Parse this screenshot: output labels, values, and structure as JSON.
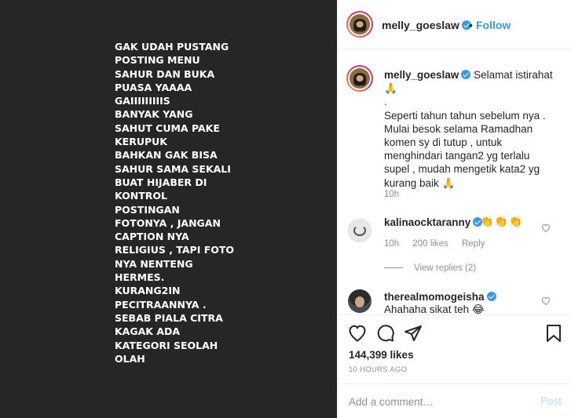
{
  "post": {
    "image_text": "GAK UDAH PUSTANG\nPOSTING MENU\nSAHUR DAN BUKA\nPUASA YAAAA\nGAIIIIIIIIIS\nBANYAK YANG\nSAHUT CUMA PAKE\nKERUPUK\nBAHKAN GAK BISA\nSAHUR SAMA SEKALI\nBUAT HIJABER DI\nKONTROL\nPOSTINGAN\nFOTONYA , JANGAN\nCAPTION NYA\nRELIGIUS , TAPI FOTO\nNYA NENTENG\nHERMES.\nKURANG2IN\nPECITRAANNYA .\nSEBAB PIALA CITRA\nKAGAK ADA\nKATEGORI SEOLAH\nOLAH"
  },
  "header": {
    "username": "melly_goeslaw",
    "separator": "•",
    "follow_label": "Follow"
  },
  "caption": {
    "username": "melly_goeslaw",
    "text": "Selamat istirahat 🙏\n.\nSeperti tahun tahun sebelum nya .\nMulai besok selama Ramadhan\nkomen sy di tutup , untuk\nmenghindari tangan2 yg terlalu\nsupel , mudah mengetik kata2 yg\nkurang baik 🙏",
    "time": "10h"
  },
  "comments": [
    {
      "username": "kalinaocktaranny",
      "text": "👏👏👏",
      "time": "10h",
      "likes": "200 likes",
      "reply_label": "Reply",
      "view_replies": "View replies (2)"
    },
    {
      "username": "therealmomogeisha",
      "text": "Ahahaha sikat teh 😂"
    }
  ],
  "actions": {
    "likes": "144,399 likes",
    "time_ago": "10 HOURS AGO"
  },
  "add_comment": {
    "placeholder": "Add a comment…",
    "post_label": "Post"
  },
  "colors": {
    "accent": "#3897f0",
    "image_bg": "#262626",
    "muted": "#8e8e8e"
  }
}
